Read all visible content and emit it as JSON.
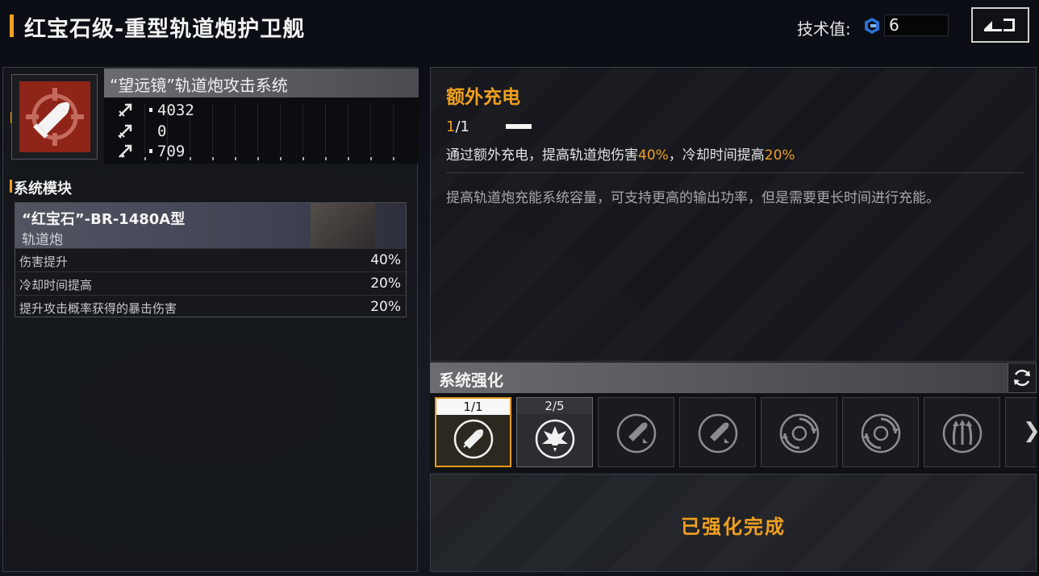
{
  "header": {
    "title": "红宝石级-重型轨道炮护卫舰",
    "tech_label": "技术值:",
    "tech_value": "6"
  },
  "weapon": {
    "name": "“望远镜”轨道炮攻击系统",
    "stats": [
      "4032",
      "0",
      "709"
    ]
  },
  "module_section": {
    "title": "系统模块",
    "module_name": "“红宝石”-BR-1480A型",
    "module_type": "轨道炮",
    "rows": [
      {
        "label": "伤害提升",
        "value": "40%"
      },
      {
        "label": "冷却时间提高",
        "value": "20%"
      },
      {
        "label": "提升攻击概率获得的暴击伤害",
        "value": "20%"
      }
    ]
  },
  "upgrade": {
    "title": "额外充电",
    "count_current": "1",
    "count_total": "/1",
    "desc_a": "通过额外充电，提高轨道炮伤害",
    "desc_v1": "40%",
    "desc_b": "，冷却时间提高",
    "desc_v2": "20%",
    "lore": "提高轨道炮充能系统容量，可支持更高的输出功率，但是需要更长时间进行充能。"
  },
  "enhance": {
    "title": "系统强化",
    "slots": [
      {
        "badge": "1/1",
        "icon": "railgun-charge-icon"
      },
      {
        "badge": "2/5",
        "icon": "burst-icon"
      },
      {
        "badge": "",
        "icon": "missile-up-icon"
      },
      {
        "badge": "",
        "icon": "missile-up-icon"
      },
      {
        "badge": "",
        "icon": "spin-arrows-icon"
      },
      {
        "badge": "",
        "icon": "spin-arrows-icon"
      },
      {
        "badge": "",
        "icon": "triple-arrows-up-icon"
      }
    ],
    "done_text": "已强化完成"
  },
  "colors": {
    "accent": "#f0a020",
    "weapon_icon_bg": "#8f2418"
  }
}
